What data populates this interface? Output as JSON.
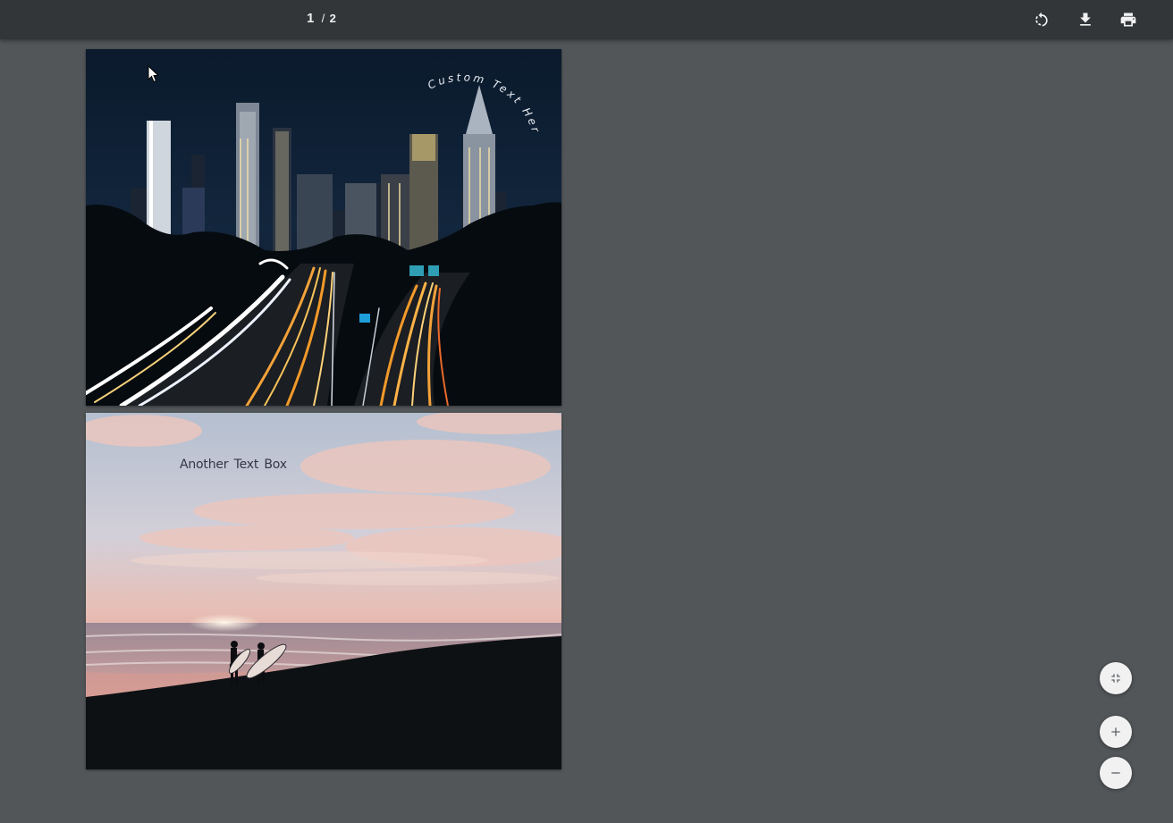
{
  "toolbar": {
    "current_page": "1",
    "separator": "/",
    "total_pages": "2",
    "rotate_label": "rotate",
    "download_label": "download",
    "print_label": "print"
  },
  "pages": [
    {
      "scene": "city-night-highway",
      "curved_text": "Custom Text Here"
    },
    {
      "scene": "beach-sunset-surfers",
      "text_box": "Another Text Box"
    }
  ],
  "zoom_controls": {
    "fit_icon": "fit-to-page-icon",
    "zoom_in_icon": "plus-icon",
    "zoom_out_icon": "minus-icon"
  },
  "colors": {
    "toolbar_bg": "#323639",
    "viewer_bg": "#525659",
    "fab_bg": "#f1f1f1"
  }
}
